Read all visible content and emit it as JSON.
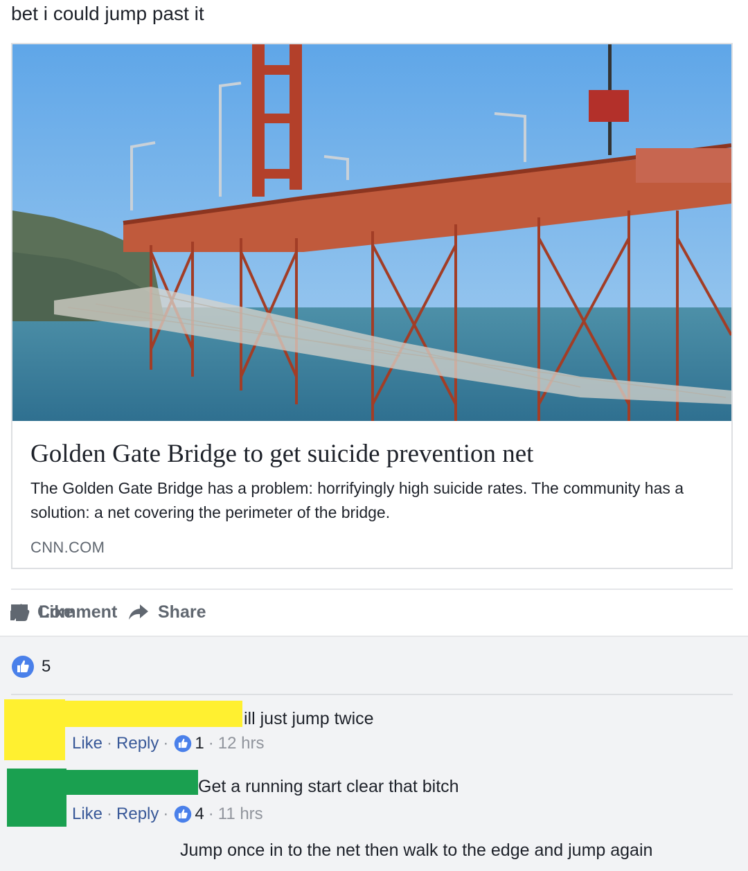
{
  "post": {
    "text": "bet i could jump past it"
  },
  "link": {
    "title": "Golden Gate Bridge to get suicide prevention net",
    "description": "The Golden Gate Bridge has a problem: horrifyingly high suicide rates. The community has a solution: a net covering the perimeter of the bridge.",
    "domain": "CNN.COM"
  },
  "actions": {
    "like": "Like",
    "comment": "Comment",
    "share": "Share"
  },
  "reactions": {
    "count": "5"
  },
  "comments": [
    {
      "text": "ill just jump twice",
      "like": "Like",
      "reply": "Reply",
      "likes": "1",
      "time": "12 hrs",
      "redact_color": "#0010e0"
    },
    {
      "text": "Get a running start clear that bitch",
      "like": "Like",
      "reply": "Reply",
      "likes": "4",
      "time": "11 hrs",
      "redact_color": "#fff030"
    },
    {
      "text": "Jump once in to the net then walk to the edge and jump again",
      "redact_color": "#1aa050"
    }
  ],
  "colors": {
    "link_blue": "#385898",
    "meta_gray": "#90949c",
    "like_blue": "#4a80ea"
  }
}
